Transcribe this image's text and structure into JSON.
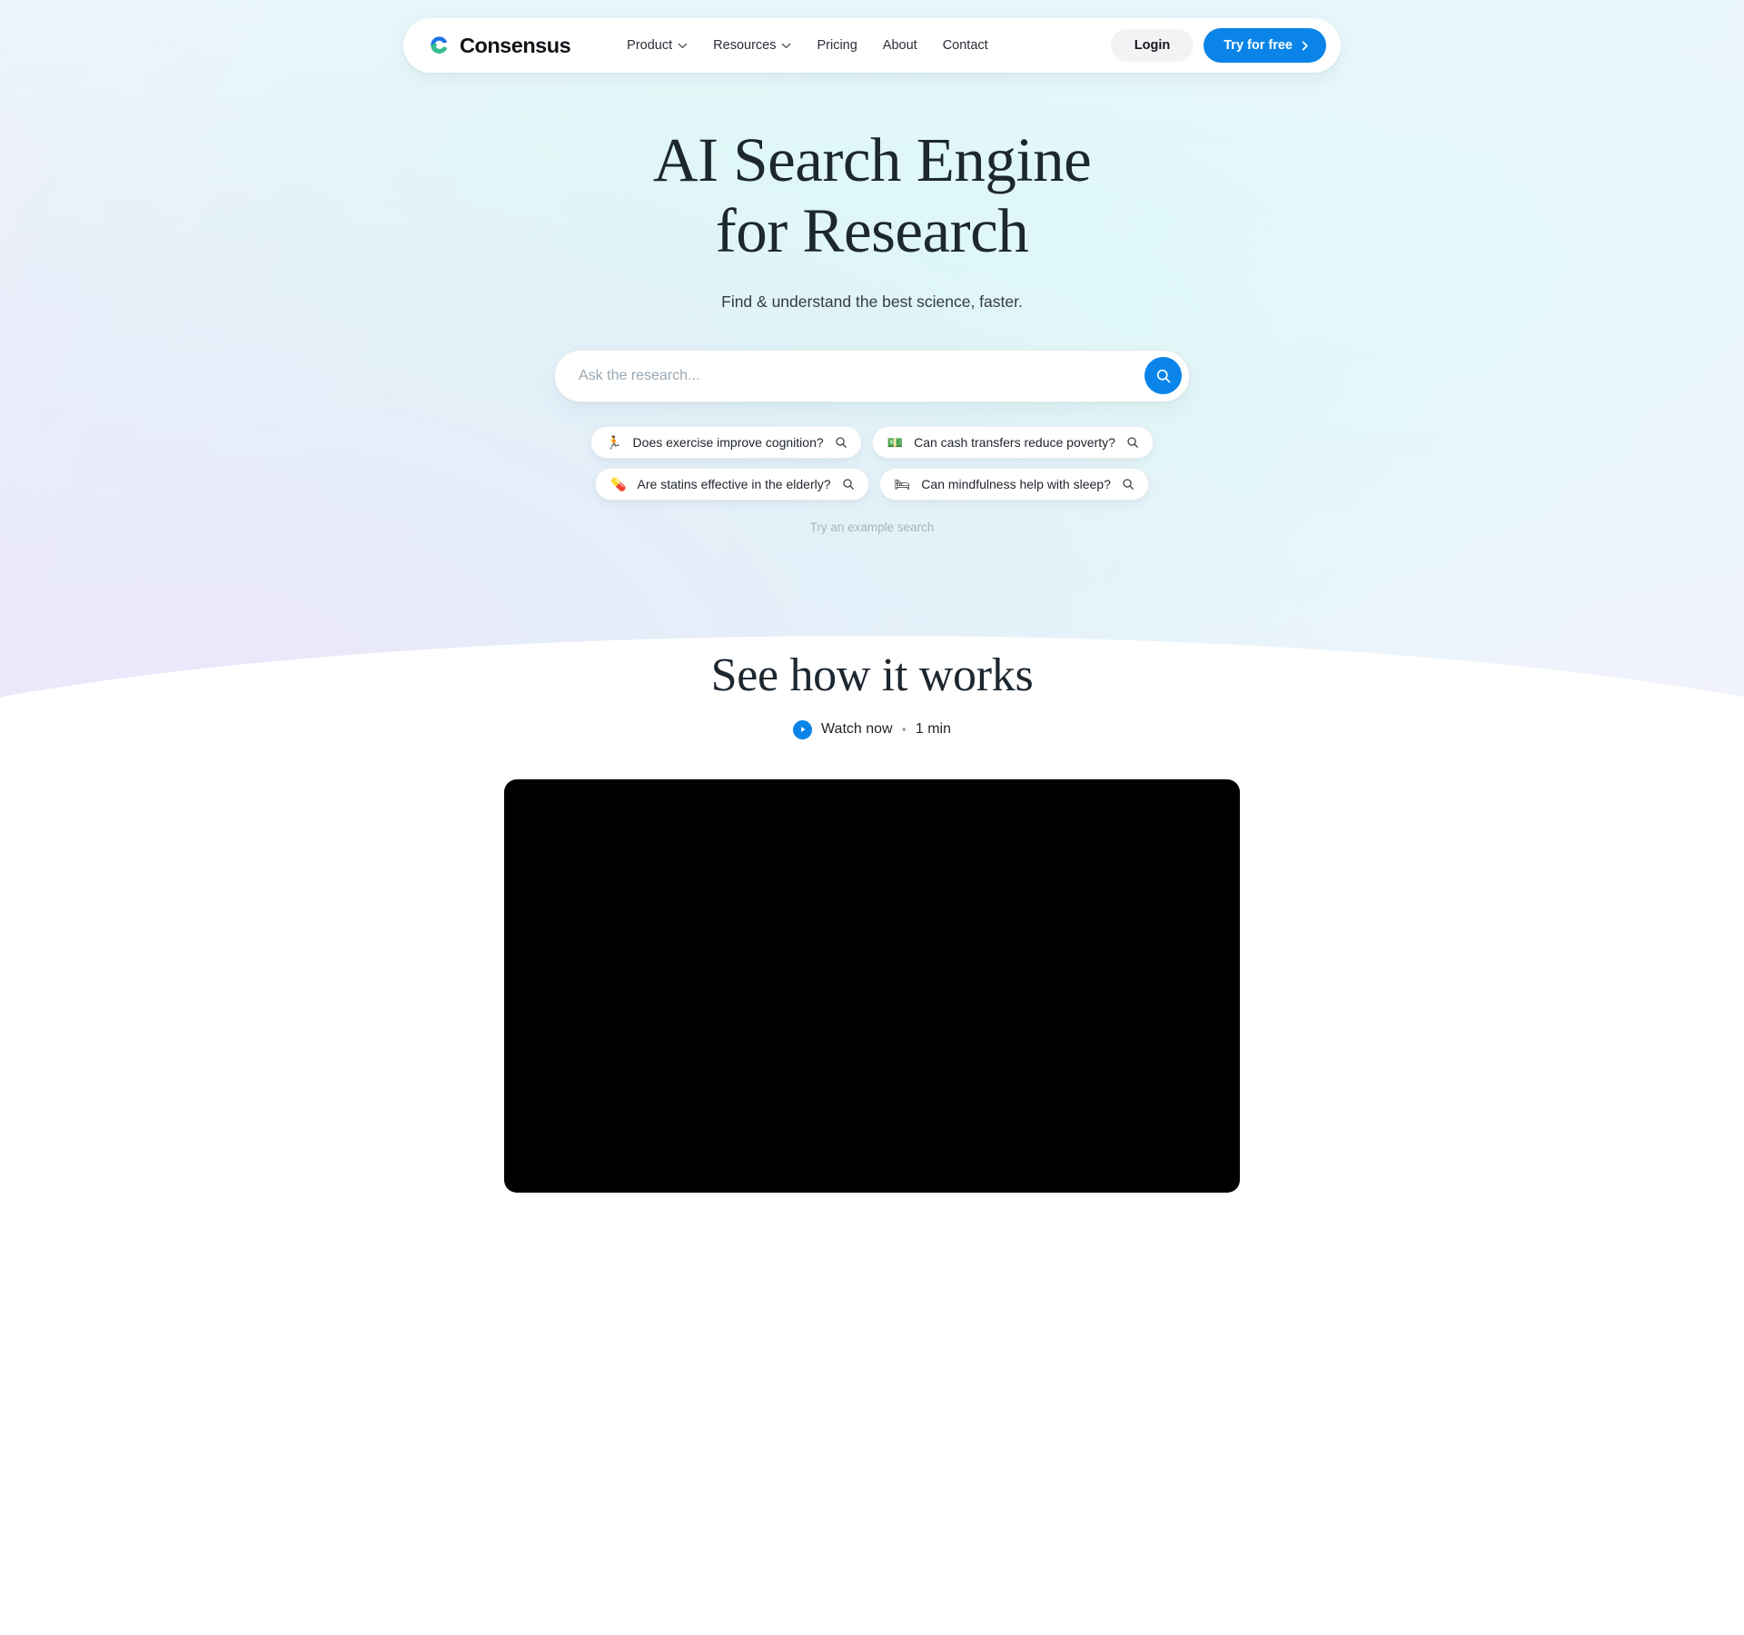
{
  "brand": {
    "name": "Consensus",
    "logo_icon": "consensus-c-logo"
  },
  "nav": {
    "links": [
      {
        "label": "Product",
        "has_caret": true
      },
      {
        "label": "Resources",
        "has_caret": true
      },
      {
        "label": "Pricing",
        "has_caret": false
      },
      {
        "label": "About",
        "has_caret": false
      },
      {
        "label": "Contact",
        "has_caret": false
      }
    ],
    "login_label": "Login",
    "try_label": "Try for free"
  },
  "hero": {
    "title_line1": "AI Search Engine",
    "title_line2": "for Research",
    "subtitle": "Find & understand the best science, faster."
  },
  "search": {
    "placeholder": "Ask the research...",
    "value": "",
    "submit_icon": "search-icon"
  },
  "chips": [
    {
      "emoji": "🏃",
      "text": "Does exercise improve cognition?"
    },
    {
      "emoji": "💵",
      "text": "Can cash transfers reduce poverty?"
    },
    {
      "emoji": "💊",
      "text": "Are statins effective in the elderly?"
    },
    {
      "emoji": "🛏",
      "text": "Can mindfulness help with sleep?"
    }
  ],
  "example_note": "Try an example search",
  "how": {
    "title": "See how it works",
    "watch_label": "Watch now",
    "separator": "•",
    "duration": "1 min"
  },
  "colors": {
    "accent_blue": "#0a84e8",
    "logo_blue": "#1a73e8",
    "logo_green": "#34bd8f",
    "heading": "#1d2730",
    "muted": "#a9b4bd"
  }
}
